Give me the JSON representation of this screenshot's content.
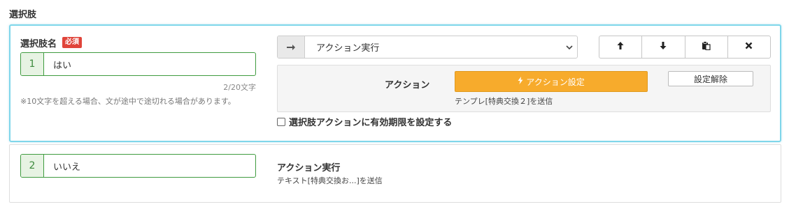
{
  "section": {
    "title": "選択肢"
  },
  "choice1": {
    "label": "選択肢名",
    "required_badge": "必須",
    "number": "1",
    "value": "はい",
    "counter": "2/20文字",
    "note": "※10文字を超える場合、文が途中で途切れる場合があります。",
    "action_select": {
      "selected": "アクション実行",
      "arrow_icon": "arrow-right-icon"
    },
    "toolbar": {
      "buttons": [
        {
          "name": "move-up-button",
          "icon": "arrow-up-icon"
        },
        {
          "name": "move-down-button",
          "icon": "arrow-down-icon"
        },
        {
          "name": "copy-button",
          "icon": "clipboard-icon"
        },
        {
          "name": "delete-button",
          "icon": "close-icon"
        }
      ]
    },
    "action_panel": {
      "label": "アクション",
      "set_button": "アクション設定",
      "set_icon": "bolt-icon",
      "clear_button": "設定解除",
      "description": "テンプレ[特典交換２]を送信"
    },
    "expiry": {
      "checked": false,
      "label": "選択肢アクションに有効期限を設定する"
    }
  },
  "choice2": {
    "number": "2",
    "value": "いいえ",
    "action_title": "アクション実行",
    "action_desc": "テキスト[特典交換お...]を送信"
  },
  "colors": {
    "active_border": "#7fd6ea",
    "input_border": "#3f9b3f",
    "required": "#e0443a",
    "action_button": "#f7ab2c"
  }
}
